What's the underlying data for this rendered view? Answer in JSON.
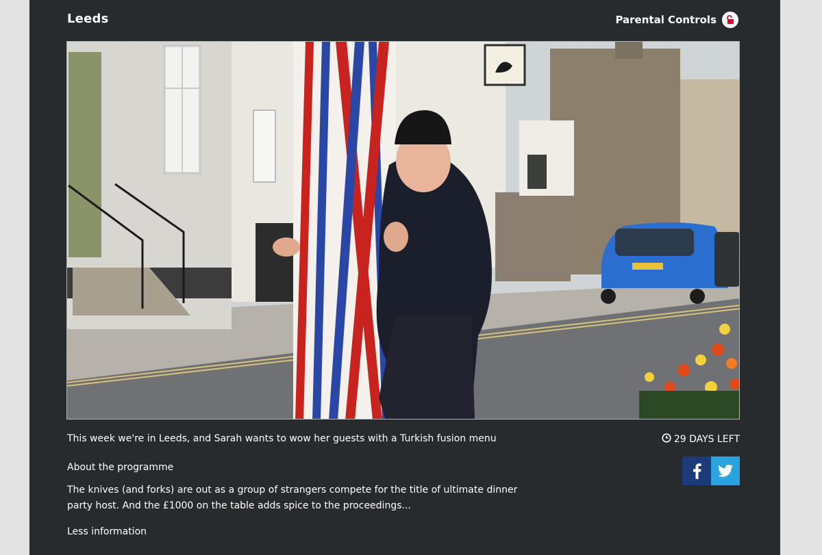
{
  "page": {
    "title": "Leeds",
    "parental_controls_label": "Parental Controls"
  },
  "episode": {
    "synopsis": "This week we're in Leeds, and Sarah wants to wow her guests with a Turkish fusion menu",
    "days_left": "29 DAYS LEFT"
  },
  "about": {
    "heading": "About the programme",
    "description": "The knives (and forks) are out as a group of strangers compete for the title of ultimate dinner party host. And the £1000 on the table adds spice to the proceedings...",
    "toggle_label": "Less information"
  },
  "share": {
    "facebook_icon": "facebook-icon",
    "twitter_icon": "twitter-icon"
  },
  "icons": {
    "parental": "lock-icon",
    "clock": "clock-icon"
  },
  "colors": {
    "panel_background": "#272b2e",
    "page_background": "#e3e3e3",
    "facebook": "#1d3a7a",
    "twitter": "#2aa3df",
    "lock_accent": "#c8102e"
  }
}
